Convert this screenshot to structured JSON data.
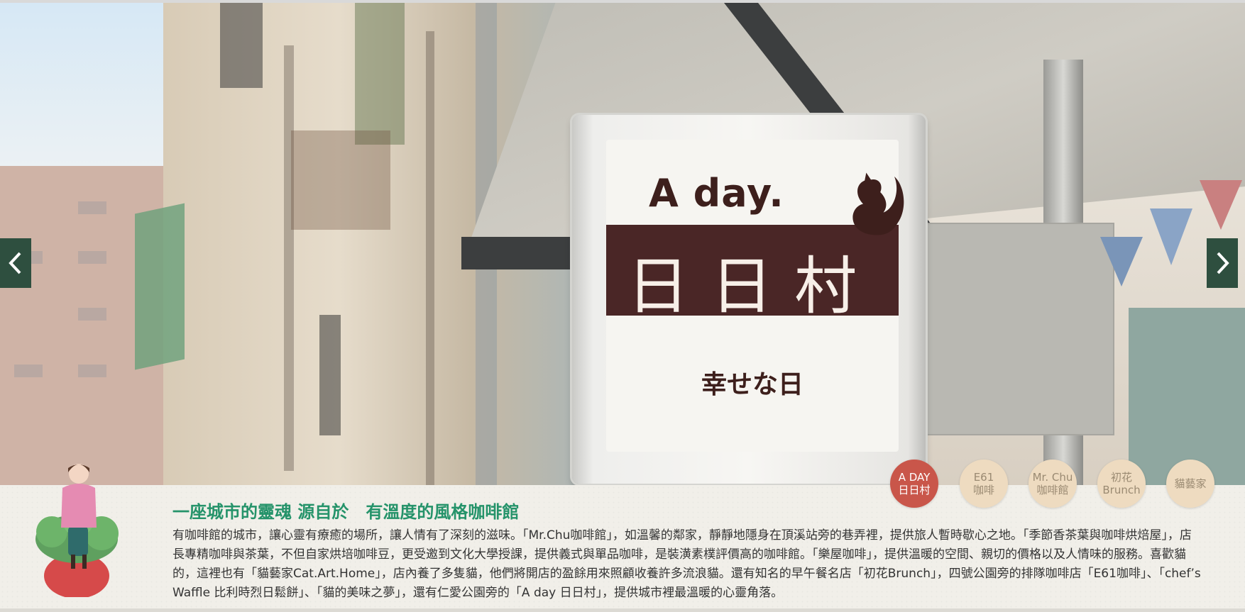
{
  "hero": {
    "sign": {
      "brand": "A day.",
      "main": "日日村",
      "sub": "幸せな日"
    },
    "prev_icon": "chevron-left-icon",
    "next_icon": "chevron-right-icon"
  },
  "cafe_nav": {
    "items": [
      {
        "line1": "A DAY",
        "line2": "日日村",
        "active": true
      },
      {
        "line1": "E61",
        "line2": "咖啡",
        "active": false
      },
      {
        "line1": "Mr. Chu",
        "line2": "咖啡館",
        "active": false
      },
      {
        "line1": "初花",
        "line2": "Brunch",
        "active": false
      },
      {
        "line1": "貓藝家",
        "line2": "",
        "active": false
      }
    ]
  },
  "intro": {
    "headline": "一座城市的靈魂 源自於　有溫度的風格咖啡館",
    "body": "有咖啡館的城市，讓心靈有療癒的場所，讓人情有了深刻的滋味。「Mr.Chu咖啡館」，如溫馨的鄰家，靜靜地隱身在頂溪站旁的巷弄裡，提供旅人暫時歇心之地。「季節香茶葉與咖啡烘焙屋」，店長專精咖啡與茶葉，不但自家烘培咖啡豆，更受邀到文化大學授課，提供義式與單品咖啡，是裝潢素樸評價高的咖啡館。「樂屋咖啡」，提供溫暖的空間、親切的價格以及人情味的服務。喜歡貓的，這裡也有「貓藝家Cat.Art.Home」，店內養了多隻貓，他們將開店的盈餘用來照顧收養許多流浪貓。還有知名的早午餐名店「初花Brunch」，四號公園旁的排隊咖啡店「E61咖啡」、「chef’s Waffle 比利時烈日鬆餅」、「貓的美味之夢」，還有仁愛公園旁的「A day 日日村」，提供城市裡最溫暖的心靈角落。"
  },
  "colors": {
    "accent_green": "#25936a",
    "nav_dark": "#2e4f3f",
    "active_circle": "#c9564a",
    "idle_circle": "#eedbc0"
  }
}
